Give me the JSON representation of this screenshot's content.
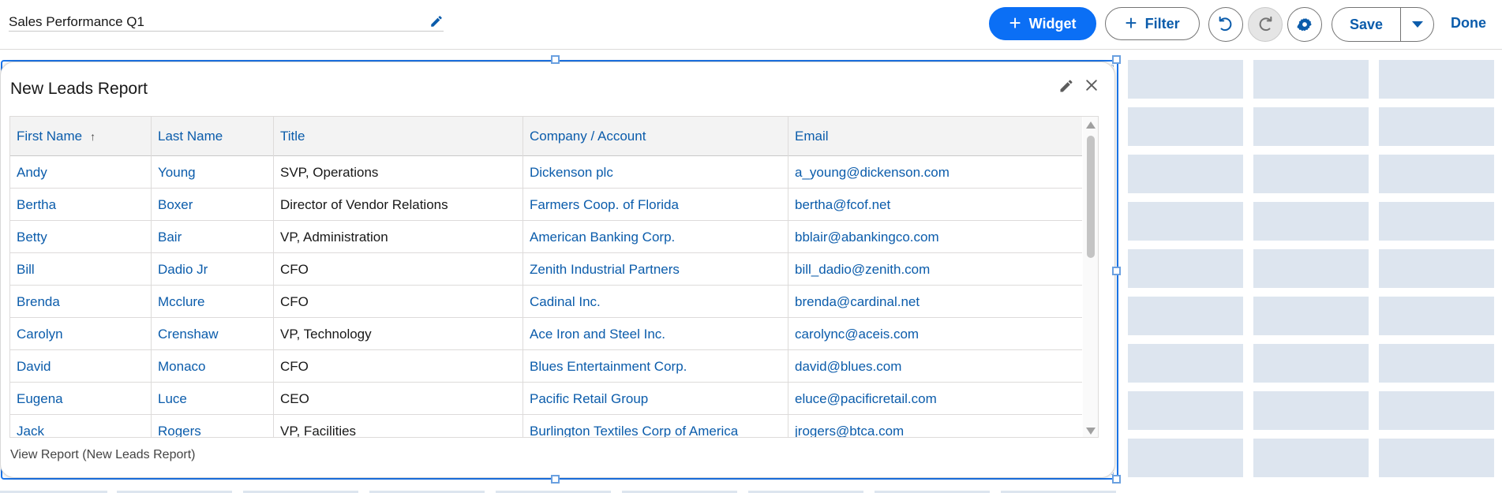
{
  "header": {
    "dashboard_title": "Sales Performance Q1",
    "widget_button": "Widget",
    "filter_button": "Filter",
    "save_button": "Save",
    "done_button": "Done"
  },
  "widget": {
    "title": "New Leads Report",
    "footer_link": "View Report (New Leads Report)"
  },
  "table": {
    "columns": [
      "First Name",
      "Last Name",
      "Title",
      "Company / Account",
      "Email"
    ],
    "sort_indicator": "↑",
    "rows": [
      [
        "Andy",
        "Young",
        "SVP, Operations",
        "Dickenson plc",
        "a_young@dickenson.com"
      ],
      [
        "Bertha",
        "Boxer",
        "Director of Vendor Relations",
        "Farmers Coop. of Florida",
        "bertha@fcof.net"
      ],
      [
        "Betty",
        "Bair",
        "VP, Administration",
        "American Banking Corp.",
        "bblair@abankingco.com"
      ],
      [
        "Bill",
        "Dadio Jr",
        "CFO",
        "Zenith Industrial Partners",
        "bill_dadio@zenith.com"
      ],
      [
        "Brenda",
        "Mcclure",
        "CFO",
        "Cadinal Inc.",
        "brenda@cardinal.net"
      ],
      [
        "Carolyn",
        "Crenshaw",
        "VP, Technology",
        "Ace Iron and Steel Inc.",
        "carolync@aceis.com"
      ],
      [
        "David",
        "Monaco",
        "CFO",
        "Blues Entertainment Corp.",
        "david@blues.com"
      ],
      [
        "Eugena",
        "Luce",
        "CEO",
        "Pacific Retail Group",
        "eluce@pacificretail.com"
      ],
      [
        "Jack",
        "Rogers",
        "VP, Facilities",
        "Burlington Textiles Corp of America",
        "jrogers@btca.com"
      ]
    ]
  },
  "icons": {
    "title_edit": "pencil-icon",
    "undo": "undo-icon",
    "redo": "redo-icon",
    "settings": "gear-icon",
    "save_menu": "chevron-down-icon",
    "widget_edit": "pencil-icon",
    "widget_close": "close-icon"
  },
  "colors": {
    "brand_blue": "#0b6ff5",
    "link_blue": "#0b5cab",
    "grid_cell": "#dde5ef",
    "selection": "#1b74e8"
  }
}
